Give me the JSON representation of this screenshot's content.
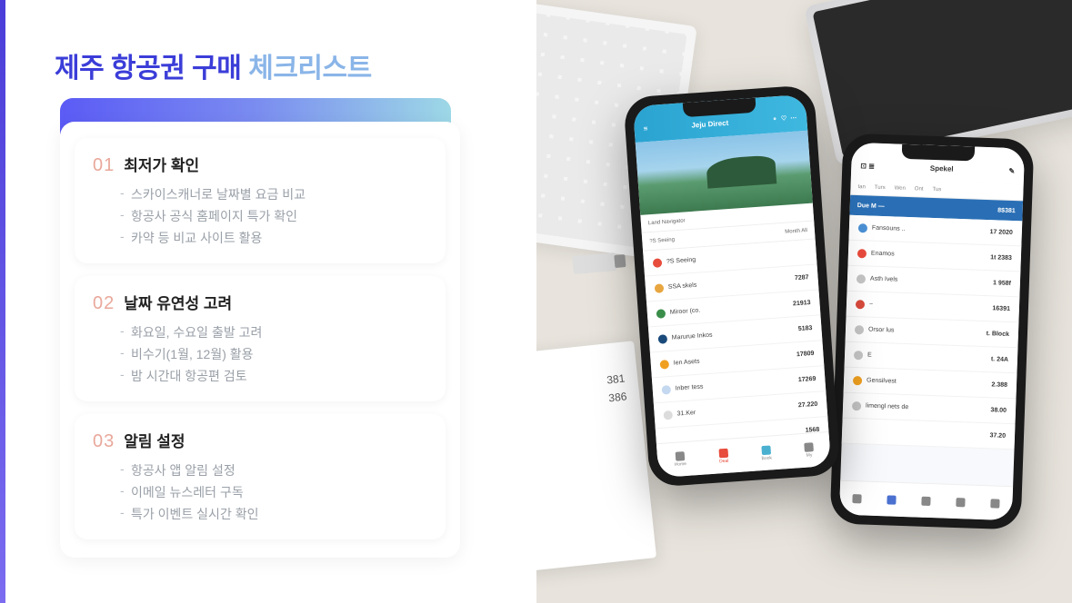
{
  "page": {
    "title_part1": "제주 항공권 구매 ",
    "title_part2": "체크리스트"
  },
  "checklist": [
    {
      "num": "01",
      "title": "최저가 확인",
      "subs": [
        "스카이스캐너로 날짜별 요금 비교",
        "항공사 공식 홈페이지 특가 확인",
        "카약 등 비교 사이트 활용"
      ]
    },
    {
      "num": "02",
      "title": "날짜 유연성 고려",
      "subs": [
        "화요일, 수요일 출발 고려",
        "비수기(1월, 12월) 활용",
        "밤 시간대 항공편 검토"
      ]
    },
    {
      "num": "03",
      "title": "알림 설정",
      "subs": [
        "항공사 앱 알림 설정",
        "이메일 뉴스레터 구독",
        "특가 이벤트 실시간 확인"
      ]
    }
  ],
  "phone1": {
    "header_left": "≡",
    "header_title": "Jeju Direct",
    "scenic_label": "Land Navigator",
    "tab_label": "?S Seeing",
    "tab_right": "Month All",
    "rows": [
      {
        "icon": "#e74c3c",
        "name": "?S Seeing",
        "price": ""
      },
      {
        "icon": "#e8a640",
        "name": "SSA skels",
        "price": "7287"
      },
      {
        "icon": "#3a8e4a",
        "name": "Miroor (co.",
        "price": "21913"
      },
      {
        "icon": "#1a4a7a",
        "name": "Marurue Inkos",
        "price": "5183"
      },
      {
        "icon": "#f0a020",
        "name": "Ien Asets",
        "price": "17809"
      },
      {
        "icon": "#c4d8f0",
        "name": "Inber tess",
        "price": "17269"
      },
      {
        "icon": "#dcdcdc",
        "name": "31.Ker",
        "price": "27.220"
      },
      {
        "icon": "",
        "name": "",
        "price": "1568"
      }
    ],
    "nav": [
      "Home",
      "Deal",
      "Book",
      "My"
    ]
  },
  "phone2": {
    "header_right": "Spekel",
    "tabs": [
      "tan",
      "Turs",
      "Wen",
      "Ont",
      "Tus"
    ],
    "blue_bar_left": "Due  M —",
    "blue_bar_right": "8$381",
    "rows": [
      {
        "icon": "#4a90d4",
        "name": "Fansouns ..",
        "price": "17 2020"
      },
      {
        "icon": "#e84a3c",
        "name": "Enamos",
        "price": "1t 2383"
      },
      {
        "icon": "#c4c4c4",
        "name": "Asth Ivels",
        "price": "1 958f"
      },
      {
        "icon": "#d84a3c",
        "name": "~",
        "price": "16391"
      },
      {
        "icon": "#c4c4c4",
        "name": "Orsor lus",
        "price": "t. Block"
      },
      {
        "icon": "#c4c4c4",
        "name": "E",
        "price": "t. 24A"
      },
      {
        "icon": "#f0a020",
        "name": "Gensilvest",
        "price": "2.388"
      },
      {
        "icon": "#c4c4c4",
        "name": "limengl nets de",
        "price": "38.00"
      },
      {
        "icon": "",
        "name": "",
        "price": "37.20"
      }
    ]
  },
  "notepad": {
    "lines": [
      "381",
      "386"
    ]
  },
  "colors": {
    "accent_start": "#4a3dd8",
    "title_blue": "#3b3dd8",
    "title_light": "#8ab5e8",
    "number": "#e9a89b"
  }
}
